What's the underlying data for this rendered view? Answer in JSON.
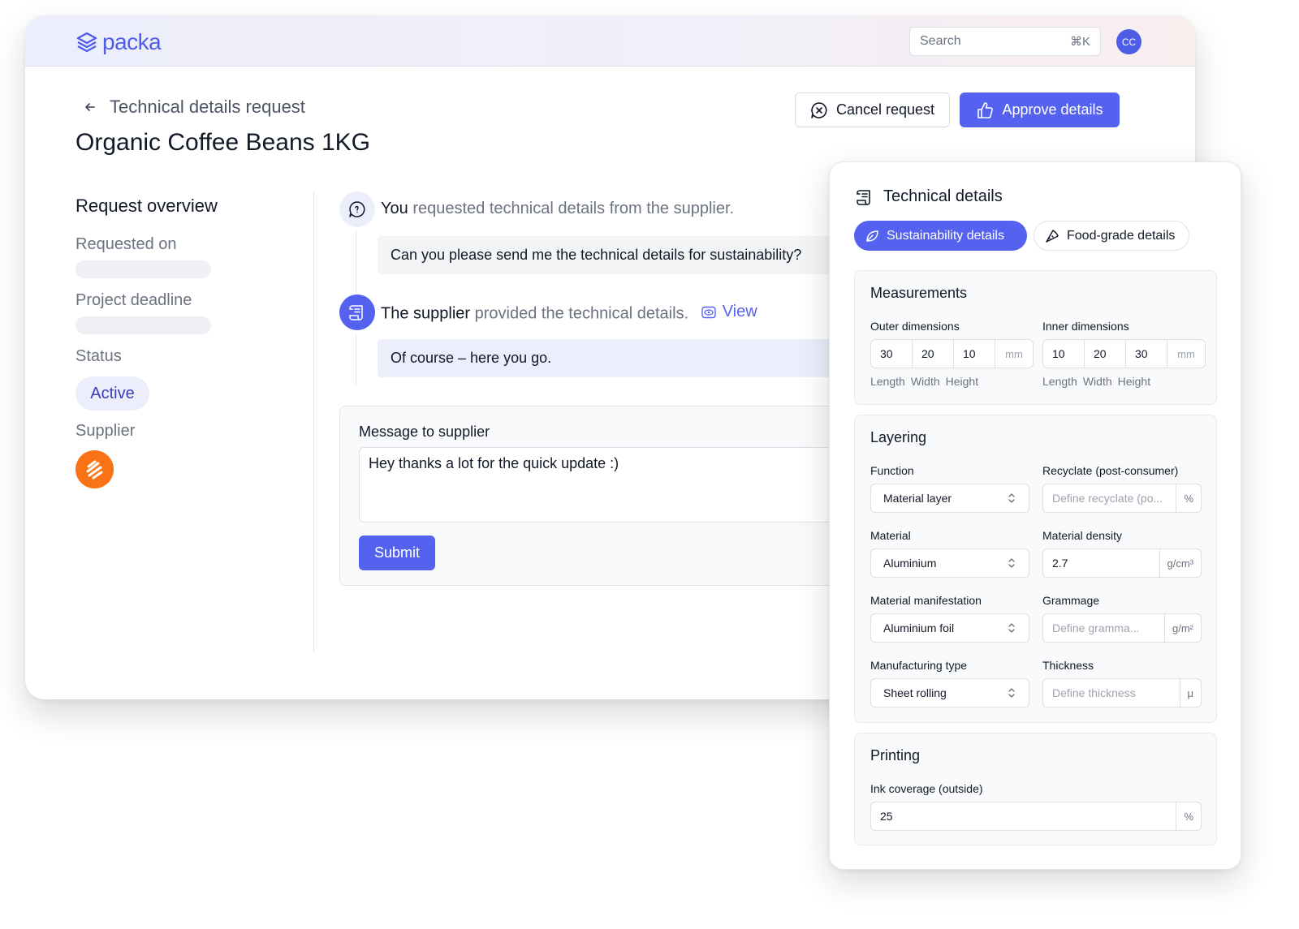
{
  "app": {
    "logo_text": "packa",
    "search_placeholder": "Search",
    "search_shortcut": "⌘K",
    "avatar_initials": "CC"
  },
  "header": {
    "breadcrumb": "Technical details request",
    "title": "Organic Coffee Beans 1KG",
    "cancel_label": "Cancel request",
    "approve_label": "Approve details"
  },
  "overview": {
    "title": "Request overview",
    "requested_on_label": "Requested on",
    "deadline_label": "Project deadline",
    "status_label": "Status",
    "status_value": "Active",
    "supplier_label": "Supplier"
  },
  "activity": [
    {
      "actor": "You",
      "action": "requested technical details from the supplier.",
      "message": "Can you please send me the technical details for sustainability?"
    },
    {
      "actor": "The supplier",
      "action": "provided the technical details.",
      "link": "View",
      "message": "Of course – here you go."
    }
  ],
  "compose": {
    "label": "Message to supplier",
    "value": "Hey thanks a lot for the quick update :)",
    "submit_label": "Submit"
  },
  "panel": {
    "title": "Technical details",
    "tabs": [
      "Sustainability details",
      "Food-grade details"
    ],
    "measurements": {
      "title": "Measurements",
      "outer": {
        "label": "Outer dimensions",
        "values": [
          "30",
          "20",
          "10"
        ],
        "unit": "mm",
        "sublabels": [
          "Length",
          "Width",
          "Height"
        ]
      },
      "inner": {
        "label": "Inner dimensions",
        "values": [
          "10",
          "20",
          "30"
        ],
        "unit": "mm",
        "sublabels": [
          "Length",
          "Width",
          "Height"
        ]
      }
    },
    "layering": {
      "title": "Layering",
      "function": {
        "label": "Function",
        "value": "Material layer"
      },
      "recycle": {
        "label": "Recyclate (post-consumer)",
        "placeholder": "Define recyclate (po...",
        "unit": "%"
      },
      "material": {
        "label": "Material",
        "value": "Aluminium"
      },
      "density": {
        "label": "Material density",
        "value": "2.7",
        "unit": "g/cm³"
      },
      "manifestation": {
        "label": "Material manifestation",
        "value": "Aluminium foil"
      },
      "grammage": {
        "label": "Grammage",
        "placeholder": "Define gramma...",
        "unit": "g/m²"
      },
      "manufacturing": {
        "label": "Manufacturing type",
        "value": "Sheet rolling"
      },
      "thickness": {
        "label": "Thickness",
        "placeholder": "Define thickness",
        "unit": "μ"
      }
    },
    "printing": {
      "title": "Printing",
      "ink": {
        "label": "Ink coverage (outside)",
        "value": "25",
        "unit": "%"
      }
    }
  }
}
